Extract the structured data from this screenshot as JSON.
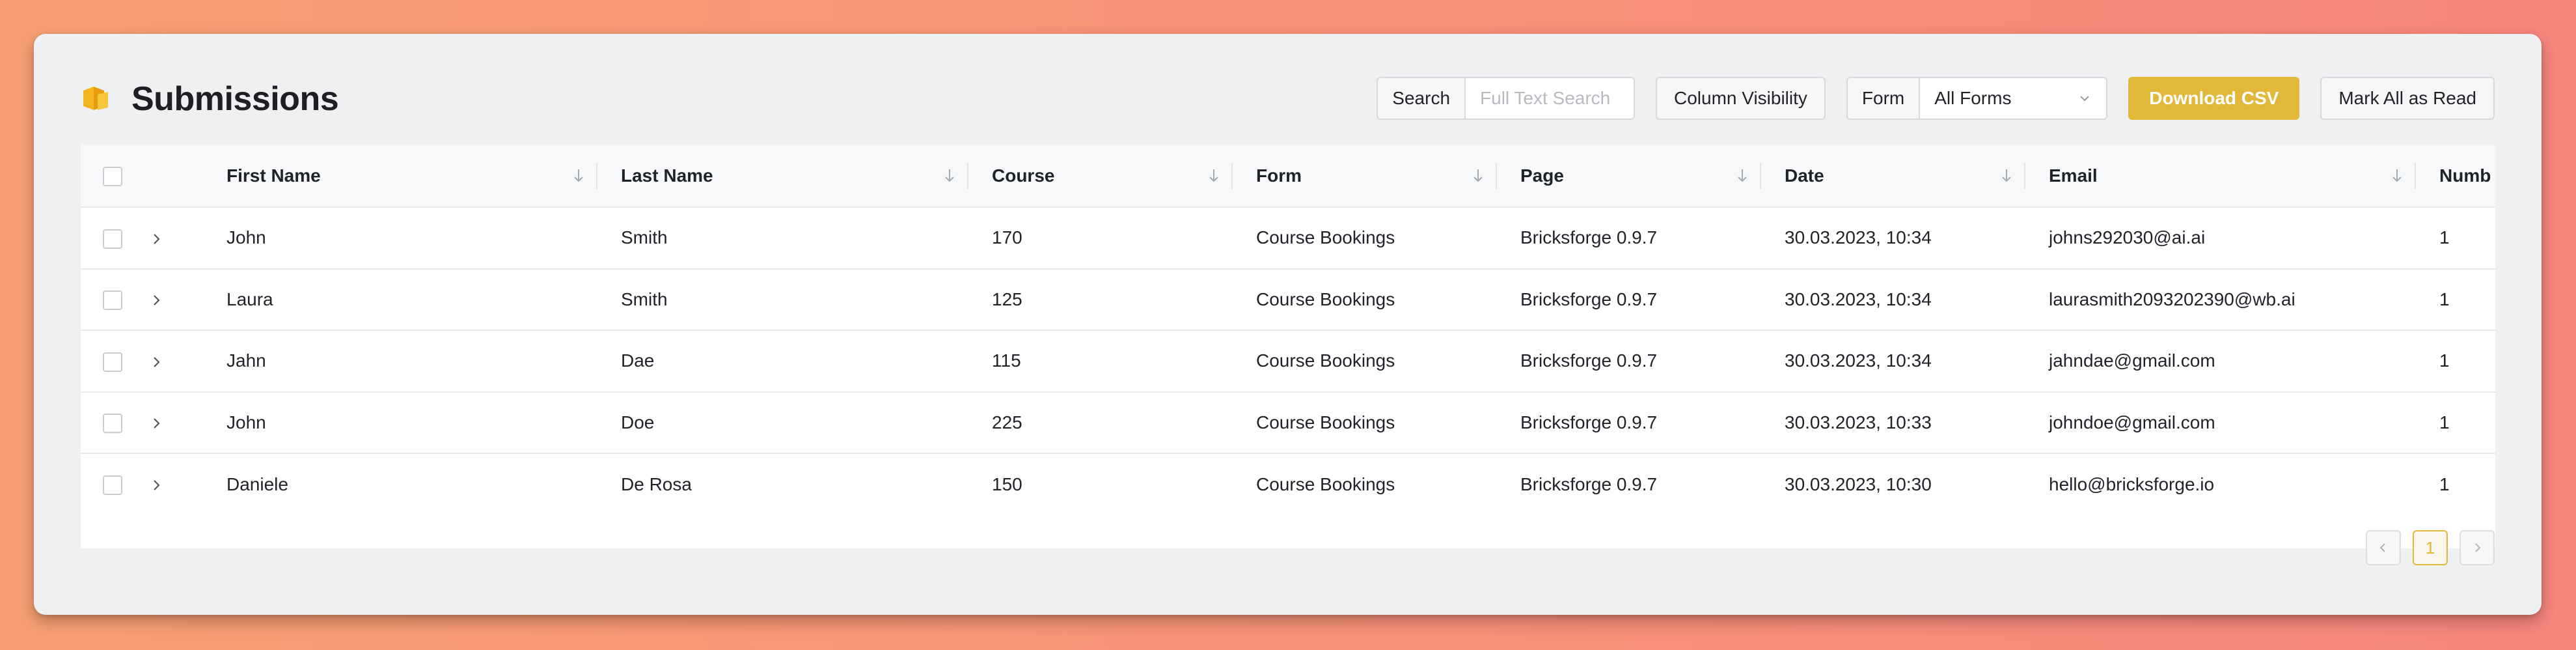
{
  "header": {
    "title": "Submissions",
    "search_label": "Search",
    "search_placeholder": "Full Text Search",
    "column_visibility_label": "Column Visibility",
    "form_label": "Form",
    "form_selected": "All Forms",
    "download_label": "Download CSV",
    "mark_read_label": "Mark All as Read"
  },
  "table": {
    "columns": [
      "First Name",
      "Last Name",
      "Course",
      "Form",
      "Page",
      "Date",
      "Email",
      "Numb"
    ],
    "rows": [
      [
        "John",
        "Smith",
        "170",
        "Course Bookings",
        "Bricksforge 0.9.7",
        "30.03.2023, 10:34",
        "johns292030@ai.ai",
        "1"
      ],
      [
        "Laura",
        "Smith",
        "125",
        "Course Bookings",
        "Bricksforge 0.9.7",
        "30.03.2023, 10:34",
        "laurasmith2093202390@wb.ai",
        "1"
      ],
      [
        "Jahn",
        "Dae",
        "115",
        "Course Bookings",
        "Bricksforge 0.9.7",
        "30.03.2023, 10:34",
        "jahndae@gmail.com",
        "1"
      ],
      [
        "John",
        "Doe",
        "225",
        "Course Bookings",
        "Bricksforge 0.9.7",
        "30.03.2023, 10:33",
        "johndoe@gmail.com",
        "1"
      ],
      [
        "Daniele",
        "De Rosa",
        "150",
        "Course Bookings",
        "Bricksforge 0.9.7",
        "30.03.2023, 10:30",
        "hello@bricksforge.io",
        "1"
      ]
    ]
  },
  "pagination": {
    "current_page": "1"
  },
  "colors": {
    "accent": "#e2b83a",
    "panel": "#eff0f2"
  }
}
